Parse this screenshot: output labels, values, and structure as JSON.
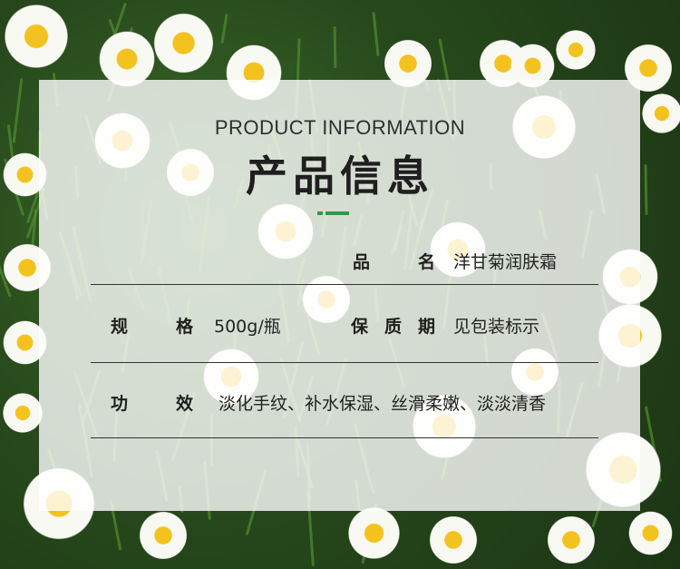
{
  "header": {
    "title_en": "PRODUCT INFORMATION",
    "title_cn": "产品信息"
  },
  "colors": {
    "accent": "#2e9a44",
    "panel": "#ffffff",
    "text": "#1f1f1f"
  },
  "info": {
    "name_label_1": "品",
    "name_label_2": "名",
    "name_value": "洋甘菊润肤霜",
    "spec_label_1": "规",
    "spec_label_2": "格",
    "spec_value": "500g/瓶",
    "shelf_label_1": "保",
    "shelf_label_2": "质",
    "shelf_label_3": "期",
    "shelf_value": "见包装标示",
    "effect_label_1": "功",
    "effect_label_2": "效",
    "effect_value": "淡化手纹、补水保湿、丝滑柔嫩、淡淡清香"
  }
}
